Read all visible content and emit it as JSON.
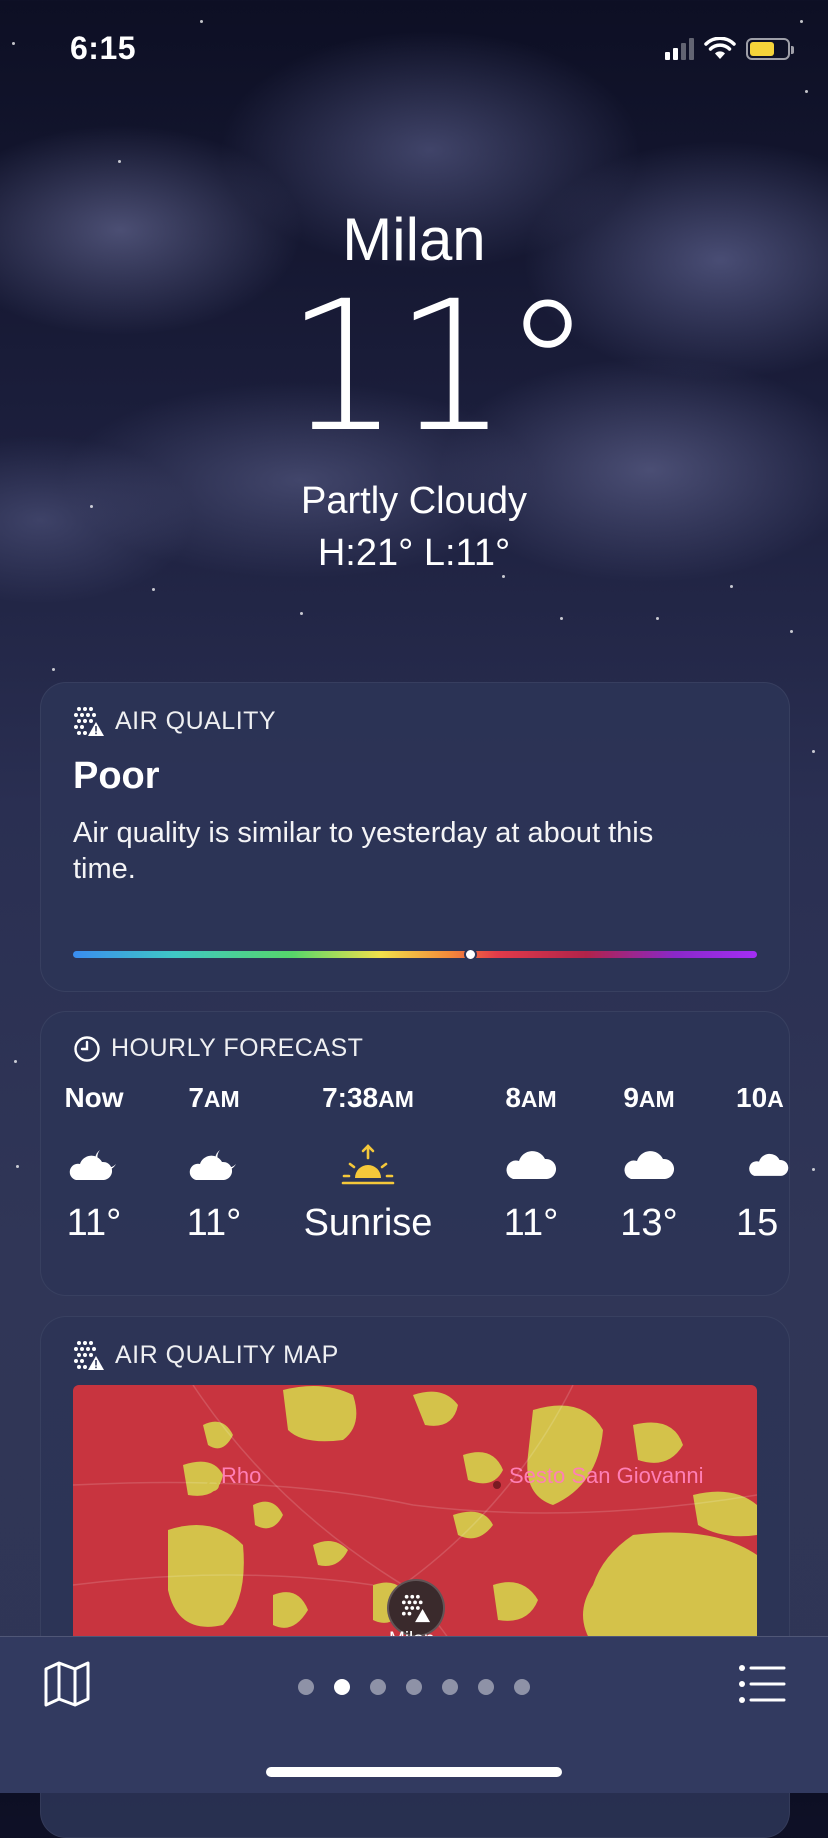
{
  "status_bar": {
    "time": "6:15"
  },
  "location": {
    "city": "Milan",
    "temperature": "11°",
    "condition": "Partly Cloudy",
    "high_low": "H:21°  L:11°"
  },
  "air_quality": {
    "header": "AIR QUALITY",
    "level": "Poor",
    "description": "Air quality is similar to yesterday at about this time.",
    "scale_position": 0.58
  },
  "hourly": {
    "header": "HOURLY FORECAST",
    "items": [
      {
        "time": "Now",
        "suffix": "",
        "icon": "cloud-moon-icon",
        "value": "11°"
      },
      {
        "time": "7",
        "suffix": "AM",
        "icon": "cloud-moon-icon",
        "value": "11°"
      },
      {
        "time": "7:38",
        "suffix": "AM",
        "icon": "sunrise-icon",
        "value": "Sunrise"
      },
      {
        "time": "8",
        "suffix": "AM",
        "icon": "cloud-icon",
        "value": "11°"
      },
      {
        "time": "9",
        "suffix": "AM",
        "icon": "cloud-icon",
        "value": "13°"
      },
      {
        "time": "10",
        "suffix": "A",
        "icon": "cloud-icon",
        "value": "15"
      }
    ]
  },
  "air_quality_map": {
    "header": "AIR QUALITY MAP",
    "labels": {
      "rho": "Rho",
      "sesto": "Sesto San Giovanni",
      "milan": "Milan"
    }
  },
  "page_indicator": {
    "count": 7,
    "active": 1
  },
  "colors": {
    "sunrise": "#f5c83a",
    "map_poor": "#c8343f",
    "map_moderate": "#d4c24a"
  }
}
